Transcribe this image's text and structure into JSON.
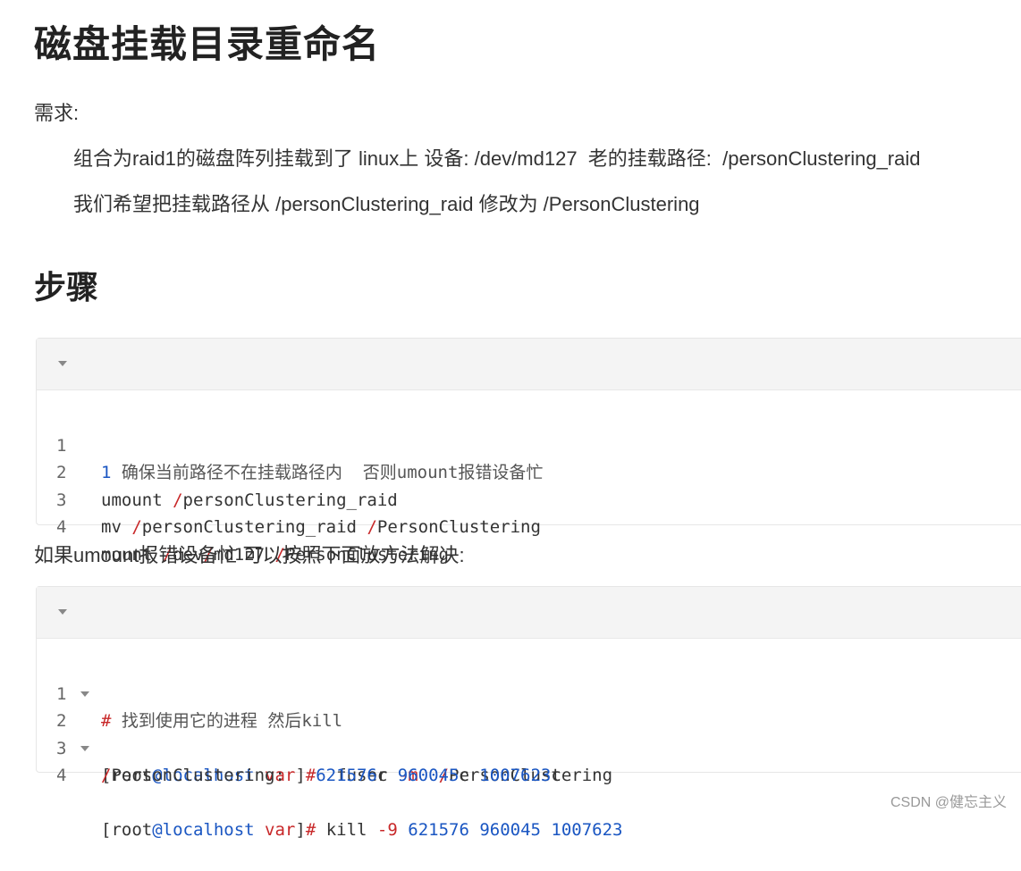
{
  "title": "磁盘挂载目录重命名",
  "requirement_label": "需求:",
  "req_line1": "组合为raid1的磁盘阵列挂载到了 linux上 设备: /dev/md127  老的挂载路径:  /personClustering_raid",
  "req_line2": "我们希望把挂载路径从 /personClustering_raid 修改为 /PersonClustering",
  "steps_heading": "步骤",
  "code1": {
    "line_numbers": [
      "1",
      "2",
      "3",
      "4"
    ],
    "l1_num": "1",
    "l1_comment": " 确保当前路径不在挂载路径内  否则umount报错设备忙",
    "l2_cmd": "umount ",
    "l2_slash": "/",
    "l2_rest": "personClustering_raid",
    "l3_cmd": "mv ",
    "l3_slash1": "/",
    "l3_mid": "personClustering_raid ",
    "l3_slash2": "/",
    "l3_rest": "PersonClustering",
    "l4_cmd": "mount ",
    "l4_s1": "/",
    "l4_dev": "dev",
    "l4_s2": "/",
    "l4_md": "md127 ",
    "l4_s3": "/",
    "l4_rest": "PersonClustering"
  },
  "between_text": "如果umount报错设备忙 可以按照下面放方法解决:",
  "code2": {
    "line_numbers": [
      "1",
      "2",
      "3",
      "4"
    ],
    "l1_hash": "#",
    "l1_comment": " 找到使用它的进程 然后kill",
    "l2_a": "[root",
    "l2_at": "@localhost",
    "l2_sp": " ",
    "l2_var": "var",
    "l2_b": "]",
    "l2_hash": "#",
    "l2_c": "  fuser ",
    "l2_flag": "-m",
    "l2_d": "  ",
    "l2_slash": "/",
    "l2_path": "PersonClustering",
    "l3_slash": "/",
    "l3_path": "PersonClustering:   ",
    "l3_n1": "621576",
    "l3_c1": "c ",
    "l3_n2": "960045",
    "l3_c2": "c ",
    "l3_n3": "1007623",
    "l3_c3": "c",
    "l4_a": "[root",
    "l4_at": "@localhost",
    "l4_sp": " ",
    "l4_var": "var",
    "l4_b": "]",
    "l4_hash": "#",
    "l4_c": " kill ",
    "l4_flag": "-9",
    "l4_nums": " 621576 960045 1007623"
  },
  "watermark": "CSDN @健忘主义"
}
